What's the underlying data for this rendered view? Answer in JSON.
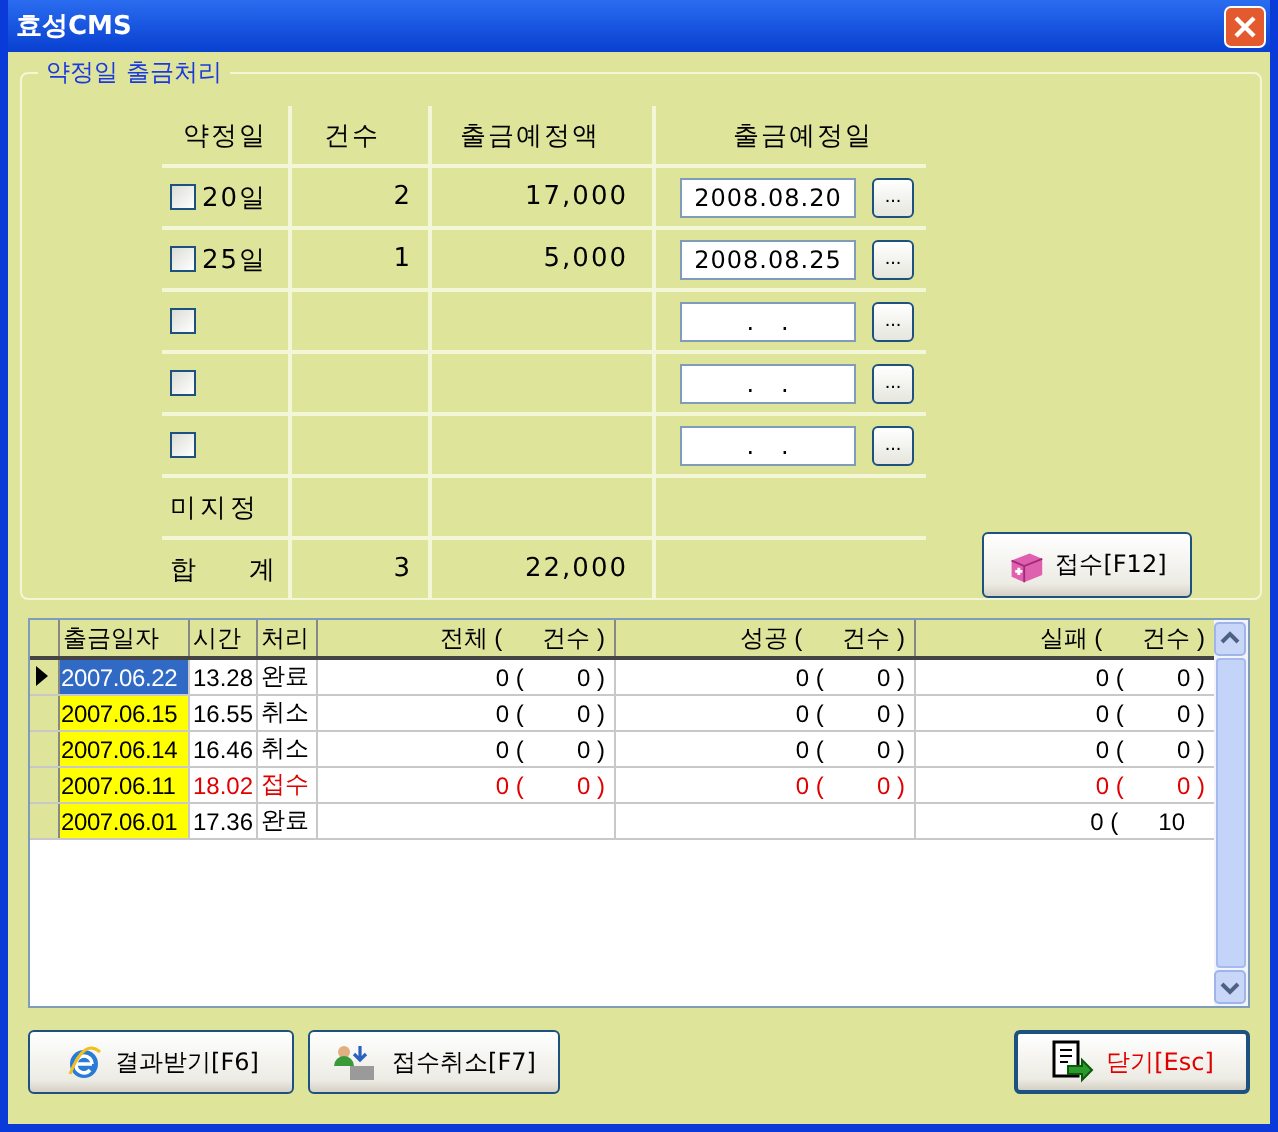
{
  "window": {
    "title": "효성CMS"
  },
  "group": {
    "title": "약정일 출금처리",
    "columns": [
      "약정일",
      "건수",
      "출금예정액",
      "출금예정일"
    ],
    "rows": [
      {
        "kind": "date",
        "checked": false,
        "label": "20일",
        "count": "2",
        "amount": "17,000",
        "date": "2008.08.20",
        "picker": "..."
      },
      {
        "kind": "date",
        "checked": false,
        "label": "25일",
        "count": "1",
        "amount": "5,000",
        "date": "2008.08.25",
        "picker": "..."
      },
      {
        "kind": "date",
        "checked": false,
        "date": ".   .",
        "picker": "..."
      },
      {
        "kind": "date",
        "checked": false,
        "date": ".   .",
        "picker": "..."
      },
      {
        "kind": "date",
        "checked": false,
        "date": ".   .",
        "picker": "..."
      },
      {
        "kind": "plain",
        "label": "미지정"
      },
      {
        "kind": "total",
        "label": "합    계",
        "count": "3",
        "amount": "22,000"
      }
    ],
    "submit_button": "접수[F12]"
  },
  "grid": {
    "columns": [
      "출금일자",
      "시간",
      "처리",
      "전체 (      건수 )",
      "성공 (      건수 )",
      "실패 (      건수 )"
    ],
    "rows": [
      {
        "selected": true,
        "alert": false,
        "date": "2007.06.22",
        "time": "13.28",
        "status": "완료",
        "total": "0 (        0 )",
        "success": "0 (        0 )",
        "fail": "0 (        0 )"
      },
      {
        "selected": false,
        "alert": false,
        "date": "2007.06.15",
        "time": "16.55",
        "status": "취소",
        "total": "0 (        0 )",
        "success": "0 (        0 )",
        "fail": "0 (        0 )"
      },
      {
        "selected": false,
        "alert": false,
        "date": "2007.06.14",
        "time": "16.46",
        "status": "취소",
        "total": "0 (        0 )",
        "success": "0 (        0 )",
        "fail": "0 (        0 )"
      },
      {
        "selected": false,
        "alert": true,
        "date": "2007.06.11",
        "time": "18.02",
        "status": "접수",
        "total": "0 (        0 )",
        "success": "0 (        0 )",
        "fail": "0 (        0 )"
      },
      {
        "selected": false,
        "alert": false,
        "date": "2007.06.01",
        "time": "17.36",
        "status": "완료",
        "fail": "0 (      10   "
      }
    ]
  },
  "buttons": [
    {
      "kind": "receive",
      "label": "결과받기[F6]"
    },
    {
      "kind": "cancel",
      "label": "접수취소[F7]"
    },
    {
      "kind": "close",
      "label": "닫기[Esc]"
    }
  ]
}
